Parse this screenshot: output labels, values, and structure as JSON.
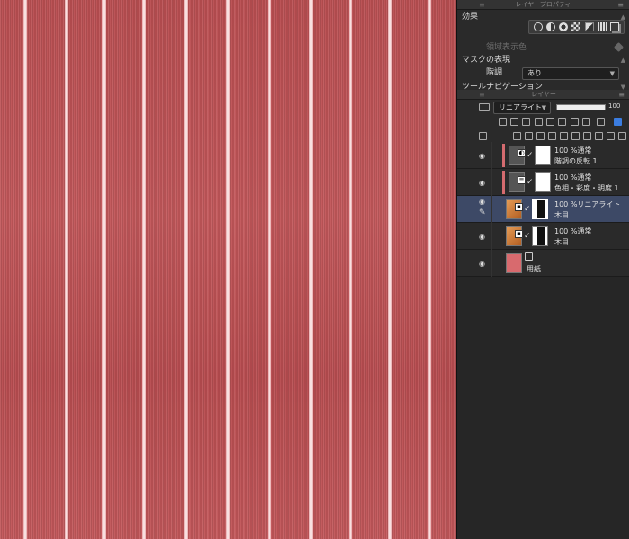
{
  "canvas": {
    "base_color": "#c45d60",
    "gap_color": "#fdf2f2"
  },
  "properties_panel": {
    "title": "レイヤープロパティ",
    "effect_label": "効果",
    "effect_icons": [
      "border-circle-icon",
      "tone-icon",
      "pattern-icon",
      "checker-icon",
      "gradient-icon",
      "grid-icon",
      "stack-icon"
    ],
    "area_color_label": "領域表示色",
    "mask_label": "マスクの表現",
    "gradation_label": "階調",
    "gradation_value": "あり",
    "tool_nav_label": "ツールナビゲーション"
  },
  "layer_panel": {
    "title": "レイヤー",
    "blend_mode": "リニアライト",
    "opacity": "100",
    "layers": [
      {
        "top": "100 %通常",
        "bottom": "階調の反転 1",
        "thumb": "dark",
        "active": false,
        "clipped": true
      },
      {
        "top": "100 %通常",
        "bottom": "色相・彩度・明度 1",
        "thumb": "dark",
        "active": false,
        "clipped": true
      },
      {
        "top": "100 %リニアライト",
        "bottom": "木目",
        "thumb": "orange",
        "active": true,
        "clipped": false
      },
      {
        "top": "100 %通常",
        "bottom": "木目",
        "thumb": "orange",
        "active": false,
        "clipped": false
      },
      {
        "top": "",
        "bottom": "用紙",
        "thumb": "red",
        "active": false,
        "clipped": false
      }
    ]
  }
}
